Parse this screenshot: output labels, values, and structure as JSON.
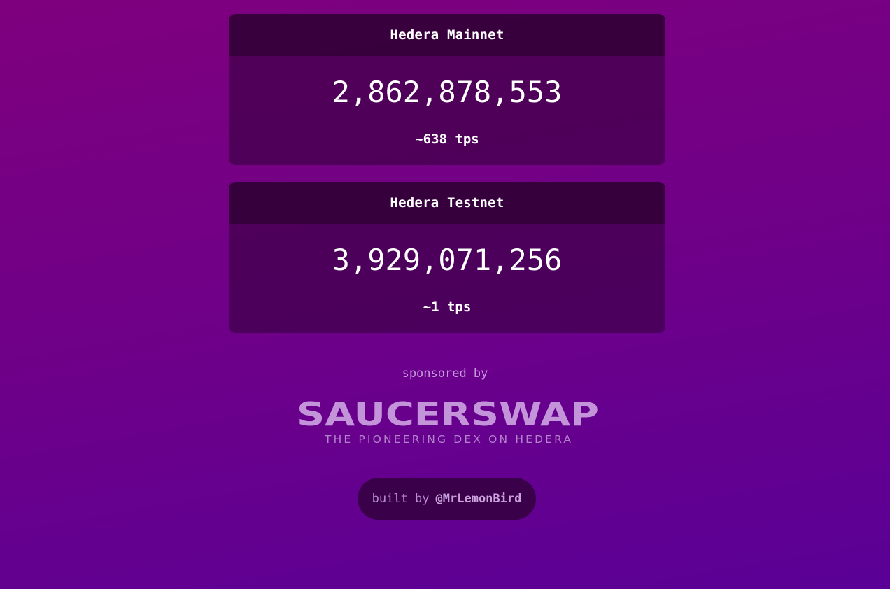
{
  "networks": [
    {
      "name": "Hedera Mainnet",
      "count": "2,862,878,553",
      "tps": "~638 tps"
    },
    {
      "name": "Hedera Testnet",
      "count": "3,929,071,256",
      "tps": "~1 tps"
    }
  ],
  "sponsor": {
    "label": "sponsored by",
    "logo_text": "SAUCERSWAP",
    "tagline": "THE PIONEERING DEX ON HEDERA"
  },
  "footer": {
    "built_by": "built by",
    "handle": "@MrLemonBird"
  },
  "colors": {
    "background_top": "#7e007e",
    "background_bottom": "#5a0096",
    "logo": "#c394d9"
  }
}
